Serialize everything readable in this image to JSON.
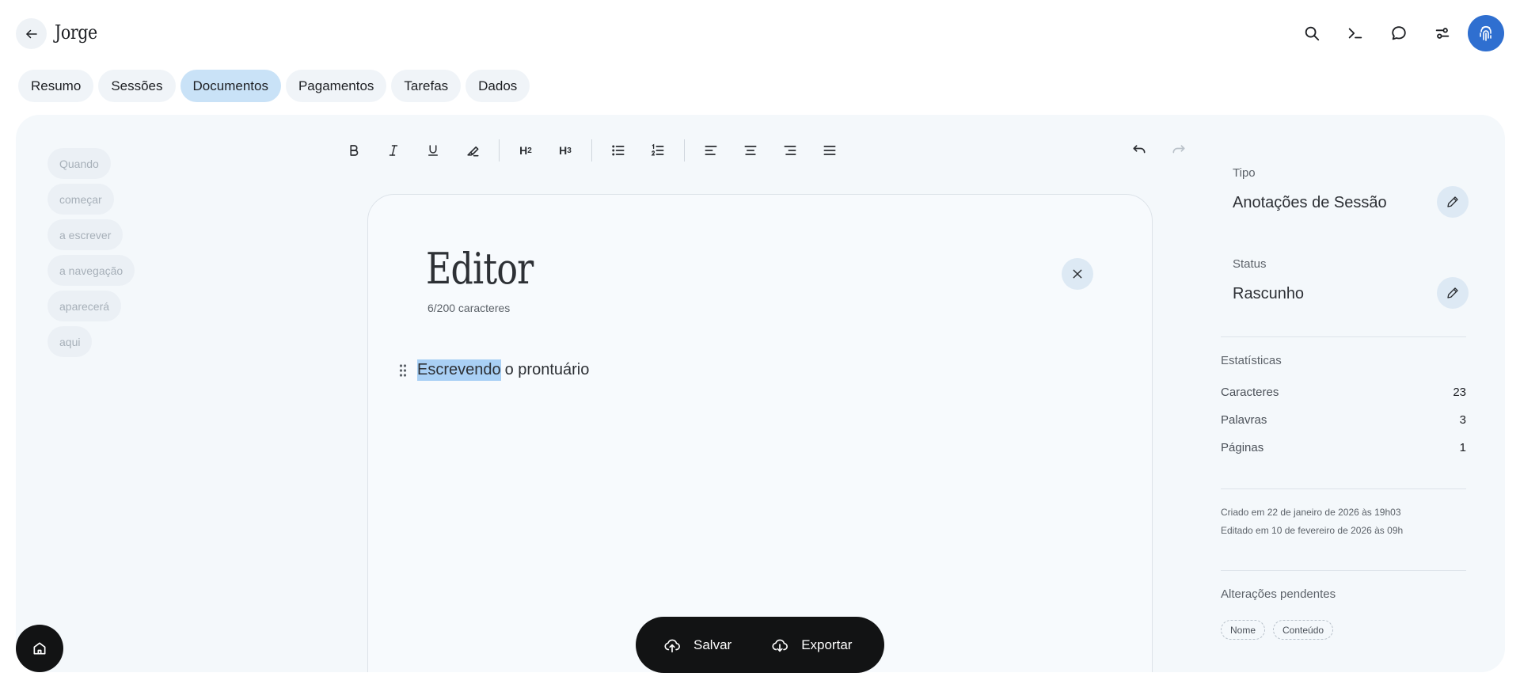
{
  "header": {
    "patient_name": "Jorge"
  },
  "tabs": [
    {
      "label": "Resumo",
      "active": false
    },
    {
      "label": "Sessões",
      "active": false
    },
    {
      "label": "Documentos",
      "active": true
    },
    {
      "label": "Pagamentos",
      "active": false
    },
    {
      "label": "Tarefas",
      "active": false
    },
    {
      "label": "Dados",
      "active": false
    }
  ],
  "outline": [
    "Quando",
    "começar",
    "a escrever",
    "a navegação",
    "aparecerá",
    "aqui"
  ],
  "toolbar": {
    "h2": "H",
    "h2_sub": "2",
    "h3": "H",
    "h3_sub": "3"
  },
  "editor": {
    "title": "Editor",
    "char_count": "6/200 caracteres",
    "selected_text": "Escrevendo",
    "rest_text": "o prontuário"
  },
  "sidebar": {
    "type_label": "Tipo",
    "type_value": "Anotações de Sessão",
    "status_label": "Status",
    "status_value": "Rascunho",
    "stats_label": "Estatísticas",
    "stats": [
      {
        "label": "Caracteres",
        "value": "23"
      },
      {
        "label": "Palavras",
        "value": "3"
      },
      {
        "label": "Páginas",
        "value": "1"
      }
    ],
    "created": "Criado em 22 de janeiro de 2026 às 19h03",
    "edited": "Editado em 10 de fevereiro de 2026 às 09h",
    "pending_label": "Alterações pendentes",
    "pending_chips": [
      "Nome",
      "Conteúdo"
    ]
  },
  "actions": {
    "save_label": "Salvar",
    "export_label": "Exportar"
  },
  "colors": {
    "accent": "#2f6fd0",
    "active_tab": "#c9e2f7",
    "selection": "#a9d0f5",
    "panel": "#f4f8fb",
    "action_bar": "#121314"
  }
}
